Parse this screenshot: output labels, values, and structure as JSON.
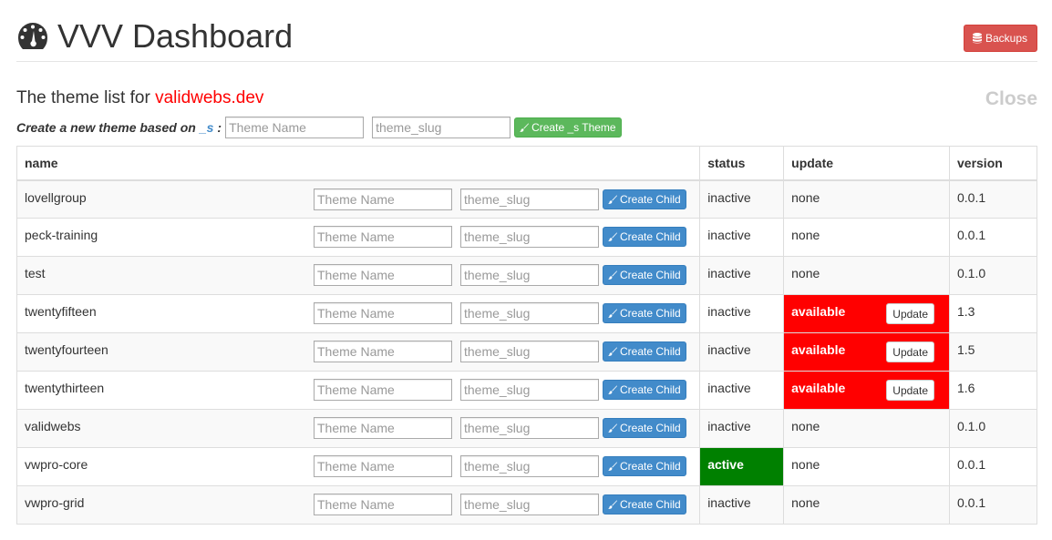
{
  "header": {
    "title": "VVV Dashboard",
    "backups_label": "Backups"
  },
  "theme_list": {
    "heading_prefix": "The theme list for ",
    "site": "validwebs.dev",
    "close_label": "Close"
  },
  "create_theme": {
    "label_prefix": "Create a new theme based on",
    "base": "_s",
    "colon": ":",
    "name_placeholder": "Theme Name",
    "slug_placeholder": "theme_slug",
    "button_label": "Create _s Theme"
  },
  "table": {
    "columns": {
      "name": "name",
      "status": "status",
      "update": "update",
      "version": "version"
    },
    "child_name_placeholder": "Theme Name",
    "child_slug_placeholder": "theme_slug",
    "create_child_label": "Create Child",
    "update_button_label": "Update",
    "rows": [
      {
        "name": "lovellgroup",
        "status": "inactive",
        "update": "none",
        "version": "0.0.1"
      },
      {
        "name": "peck-training",
        "status": "inactive",
        "update": "none",
        "version": "0.0.1"
      },
      {
        "name": "test",
        "status": "inactive",
        "update": "none",
        "version": "0.1.0"
      },
      {
        "name": "twentyfifteen",
        "status": "inactive",
        "update": "available",
        "version": "1.3"
      },
      {
        "name": "twentyfourteen",
        "status": "inactive",
        "update": "available",
        "version": "1.5"
      },
      {
        "name": "twentythirteen",
        "status": "inactive",
        "update": "available",
        "version": "1.6"
      },
      {
        "name": "validwebs",
        "status": "inactive",
        "update": "none",
        "version": "0.1.0"
      },
      {
        "name": "vwpro-core",
        "status": "active",
        "update": "none",
        "version": "0.0.1"
      },
      {
        "name": "vwpro-grid",
        "status": "inactive",
        "update": "none",
        "version": "0.0.1"
      }
    ]
  },
  "colors": {
    "danger": "#d9534f",
    "success": "#5cb85c",
    "primary": "#428bca",
    "update_available": "#ff0000",
    "active_status": "#008000",
    "site_name": "#ff0000"
  },
  "icons": {
    "logo": "dashboard-gauge-icon",
    "backups": "database-icon",
    "create": "paint-brush-icon"
  }
}
